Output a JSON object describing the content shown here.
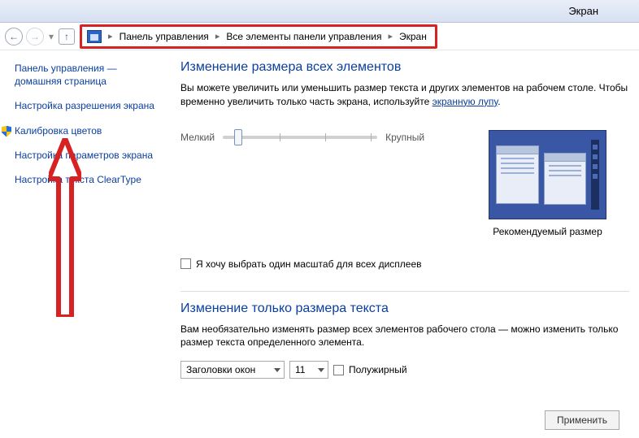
{
  "window": {
    "title": "Экран"
  },
  "breadcrumb": {
    "item1": "Панель управления",
    "item2": "Все элементы панели управления",
    "item3": "Экран"
  },
  "sidebar": {
    "home": "Панель управления —\nдомашняя страница",
    "resolution": "Настройка разрешения экрана",
    "calibration": "Калибровка цветов",
    "params": "Настройка параметров экрана",
    "cleartype": "Настройка текста ClearType"
  },
  "main": {
    "heading1": "Изменение размера всех элементов",
    "desc1a": "Вы можете увеличить или уменьшить размер текста и других элементов на рабочем столе. Чтобы временно увеличить только часть экрана, используйте ",
    "desc1link": "экранную лупу",
    "desc1b": ".",
    "slider_small": "Мелкий",
    "slider_large": "Крупный",
    "preview_caption": "Рекомендуемый размер",
    "checkbox_label": "Я хочу выбрать один масштаб для всех дисплеев",
    "heading2": "Изменение только размера текста",
    "desc2": "Вам необязательно изменять размер всех элементов рабочего стола — можно изменить только размер текста определенного элемента.",
    "select_element": "Заголовки окон",
    "select_size": "11",
    "bold_label": "Полужирный",
    "apply_btn": "Применить"
  }
}
